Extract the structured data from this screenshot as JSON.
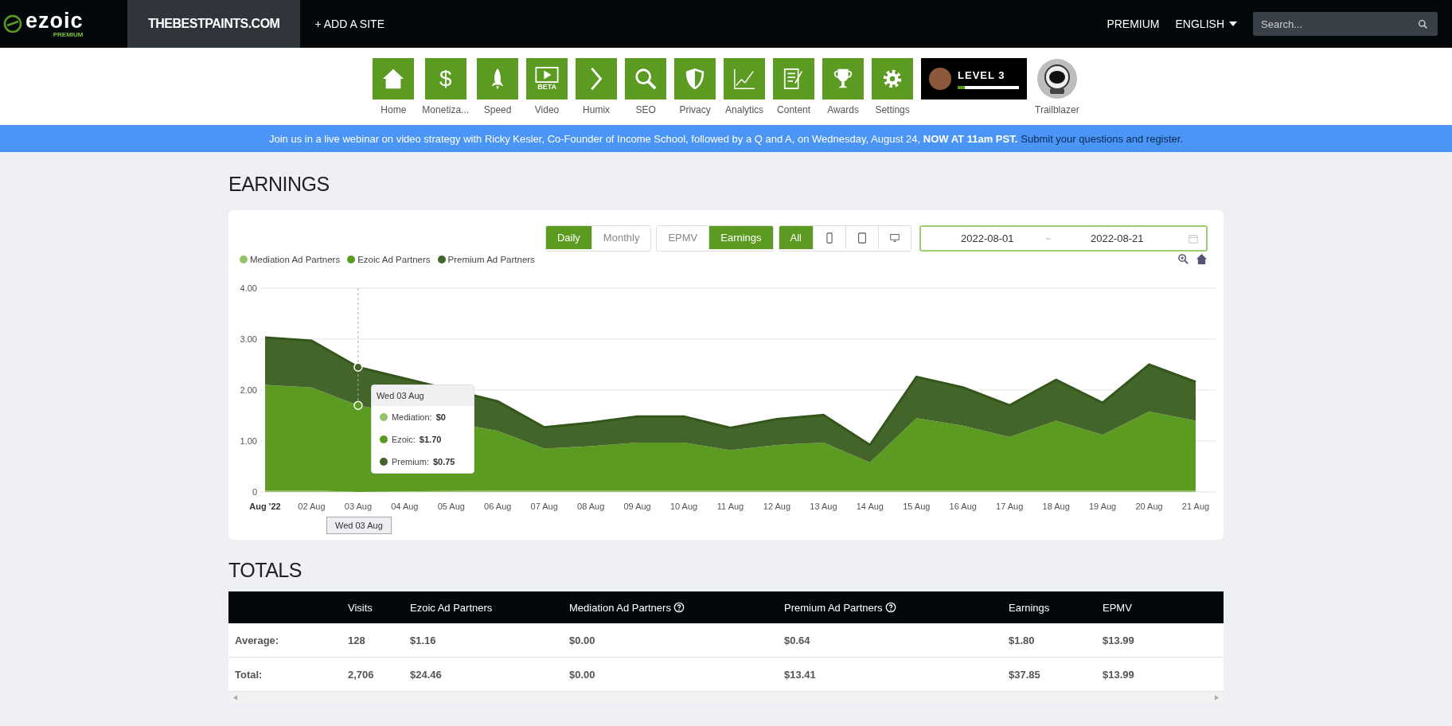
{
  "nav": {
    "logo": "ezoic",
    "logo_badge": "PREMIUM",
    "site": "THEBESTPAINTS.COM",
    "add_site": "+ ADD A SITE",
    "premium": "PREMIUM",
    "language": "ENGLISH",
    "search": {
      "placeholder": "Search..."
    }
  },
  "apps": [
    {
      "kind": "home",
      "label": "Home"
    },
    {
      "kind": "money",
      "label": "Monetiza...",
      "glyph": "$"
    },
    {
      "kind": "rocket",
      "label": "Speed"
    },
    {
      "kind": "video",
      "label": "Video",
      "badge": "BETA"
    },
    {
      "kind": "chevron",
      "label": "Humix"
    },
    {
      "kind": "search",
      "label": "SEO"
    },
    {
      "kind": "shield",
      "label": "Privacy"
    },
    {
      "kind": "analytics",
      "label": "Analytics"
    },
    {
      "kind": "document",
      "label": "Content"
    },
    {
      "kind": "trophy",
      "label": "Awards"
    },
    {
      "kind": "gear",
      "label": "Settings"
    }
  ],
  "level_badge": {
    "label": "LEVEL 3",
    "level": 0.12
  },
  "achievement": {
    "label": "Trailblazer"
  },
  "banner": {
    "text": "Join us in a live webinar on video strategy with Ricky Kesler, Co-Founder of Income School, followed by a Q and A, on Wednesday, August 24, **NOW AT 11am PST.**",
    "link": "Submit your questions and register."
  },
  "earnings": {
    "title": "EARNINGS",
    "period_toggle": [
      {
        "label": "Daily",
        "selected": true
      },
      {
        "label": "Monthly",
        "selected": false
      }
    ],
    "metric_toggle": [
      {
        "label": "EPMV",
        "selected": false
      },
      {
        "label": "Earnings",
        "selected": true
      }
    ],
    "device_toggle": [
      {
        "kind": "all",
        "label": "All",
        "selected": true
      },
      {
        "kind": "phone",
        "selected": false
      },
      {
        "kind": "tablet",
        "selected": false
      },
      {
        "kind": "desktop",
        "selected": false
      }
    ],
    "date_range": {
      "start": "2022-08-01",
      "separator": "~",
      "end": "2022-08-21"
    },
    "chart_data": {
      "type": "area",
      "stacked": true,
      "categories": [
        "Aug '22",
        "02 Aug",
        "03 Aug",
        "04 Aug",
        "05 Aug",
        "06 Aug",
        "07 Aug",
        "08 Aug",
        "09 Aug",
        "10 Aug",
        "11 Aug",
        "12 Aug",
        "13 Aug",
        "14 Aug",
        "15 Aug",
        "16 Aug",
        "17 Aug",
        "18 Aug",
        "19 Aug",
        "20 Aug",
        "21 Aug"
      ],
      "series": [
        {
          "name": "Mediation Ad Partners",
          "color": "#94c36b",
          "values": [
            0.03,
            0.03,
            0,
            0.03,
            0.03,
            0.03,
            0.03,
            0.03,
            0.03,
            0.03,
            0.03,
            0.03,
            0.03,
            0.03,
            0.03,
            0.03,
            0.03,
            0.03,
            0.03,
            0.03,
            0.03
          ]
        },
        {
          "name": "Ezoic Ad Partners",
          "color": "#5c9b22",
          "values": [
            2.07,
            2.02,
            1.7,
            null,
            null,
            1.17,
            0.82,
            0.87,
            0.94,
            0.94,
            0.79,
            0.89,
            0.94,
            0.55,
            1.42,
            1.27,
            1.05,
            1.37,
            1.09,
            1.55,
            1.37
          ]
        },
        {
          "name": "Premium Ad Partners",
          "color": "#44652a",
          "values": [
            0.93,
            0.92,
            0.75,
            null,
            null,
            0.58,
            0.42,
            0.46,
            0.51,
            0.51,
            0.44,
            0.51,
            0.54,
            0.34,
            0.81,
            0.75,
            0.62,
            0.8,
            0.63,
            0.92,
            0.76
          ]
        }
      ],
      "ylim": [
        0,
        4
      ],
      "grid": true,
      "yticks": [
        {
          "value": 0,
          "label": "0"
        },
        {
          "value": 1,
          "label": "1.00"
        },
        {
          "value": 2,
          "label": "2.00"
        },
        {
          "value": 3,
          "label": "3.00"
        },
        {
          "value": 4,
          "label": "4.00"
        }
      ]
    },
    "tooltip": {
      "title": "Wed 03 Aug",
      "axis_label": "Wed 03 Aug",
      "rows": [
        {
          "label": "Mediation:",
          "value": "$0"
        },
        {
          "label": "Ezoic:",
          "value": "$1.70"
        },
        {
          "label": "Premium:",
          "value": "$0.75"
        }
      ]
    }
  },
  "totals": {
    "title": "TOTALS",
    "columns": [
      {
        "label": "Visits",
        "help": false
      },
      {
        "label": "Ezoic Ad Partners",
        "help": false
      },
      {
        "label": "Mediation Ad Partners",
        "help": true
      },
      {
        "label": "Premium Ad Partners",
        "help": true
      },
      {
        "label": "Earnings",
        "help": false
      },
      {
        "label": "EPMV",
        "help": false
      }
    ],
    "rows": [
      {
        "label": "Average:",
        "cells": [
          "128",
          "$1.16",
          "$0.00",
          "$0.64",
          "$1.80",
          "$13.99"
        ]
      },
      {
        "label": "Total:",
        "cells": [
          "2,706",
          "$24.46",
          "$0.00",
          "$13.41",
          "$37.85",
          "$13.99"
        ]
      }
    ]
  }
}
